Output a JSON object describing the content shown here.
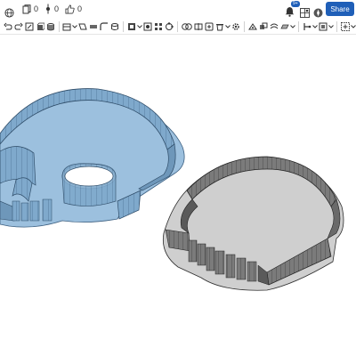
{
  "header": {
    "versions_count": "0",
    "branches_count": "0",
    "likes_count": "0",
    "notifications_badge": "9+",
    "share_label": "Share"
  },
  "toolbar": {
    "tools": [
      "sketch",
      "extrude",
      "revolve",
      "sweep",
      "loft",
      "thicken",
      "fillet",
      "chamfer",
      "draft",
      "rib",
      "shell",
      "hole",
      "linear-pattern",
      "circular-pattern",
      "mirror",
      "boolean",
      "split",
      "transform",
      "delete-part",
      "modify-fillet",
      "move-face",
      "replace-face",
      "offset-surface",
      "plane",
      "mate-connector",
      "helix",
      "variable",
      "measure",
      "section-view",
      "add"
    ]
  },
  "colors": {
    "accent": "#1f5fb8",
    "selected_part": "#8fb6d6",
    "unselected_part": "#8a8a8a"
  },
  "viewport": {
    "parts": [
      {
        "name": "skull-cutter-selected",
        "state": "selected"
      },
      {
        "name": "skull-cutter",
        "state": "unselected"
      }
    ]
  }
}
